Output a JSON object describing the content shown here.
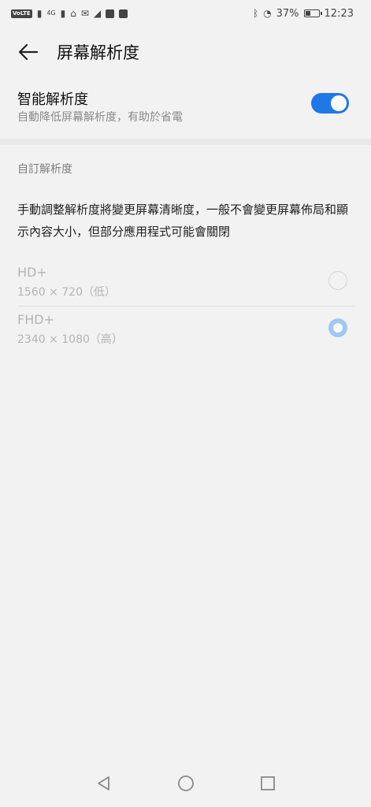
{
  "status_bar": {
    "carrier_badge": "VoLTE",
    "network": "4G",
    "battery": "37%",
    "battery_level": 0.37,
    "time": "12:23"
  },
  "app_bar": {
    "title": "屏幕解析度",
    "back_icon": "arrow-left-icon"
  },
  "smart_resolution": {
    "title": "智能解析度",
    "subtitle": "自動降低屏幕解析度，有助於省電",
    "enabled": true
  },
  "custom_resolution": {
    "section_label": "自訂解析度",
    "description": "手動調整解析度將變更屏幕清晰度，一般不會變更屏幕佈局和顯示內容大小，但部分應用程式可能會關閉",
    "options": [
      {
        "name": "HD+",
        "dimensions": "1560 × 720（低）",
        "selected": false
      },
      {
        "name": "FHD+",
        "dimensions": "2340 × 1080（高）",
        "selected": true
      }
    ]
  },
  "colors": {
    "accent": "#1e78e6",
    "radio_selected": "#9fc8f2"
  },
  "nav_bar": {
    "icons": [
      "back-triangle-icon",
      "home-circle-icon",
      "recents-square-icon"
    ]
  }
}
